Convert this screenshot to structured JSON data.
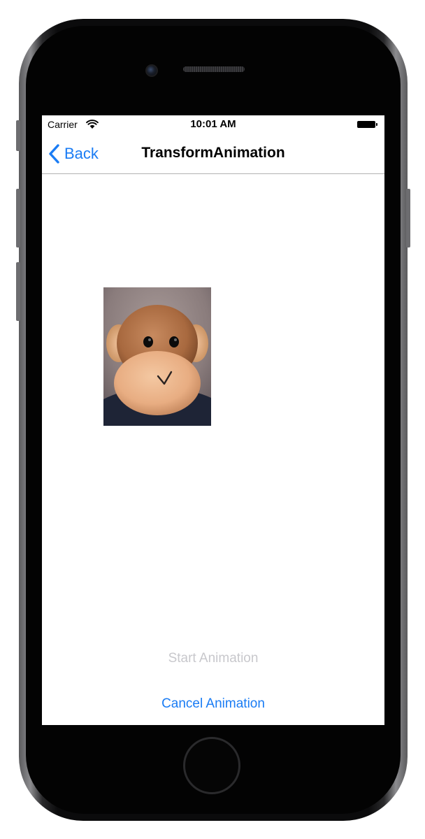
{
  "status_bar": {
    "carrier": "Carrier",
    "time": "10:01 AM",
    "wifi_icon": "wifi-icon",
    "battery_icon": "battery-icon",
    "battery_level": 1.0
  },
  "nav_bar": {
    "back_label": "Back",
    "back_icon": "chevron-left-icon",
    "title": "TransformAnimation"
  },
  "content": {
    "image_subject": "monkey plush toy photo"
  },
  "buttons": {
    "start_label": "Start Animation",
    "start_enabled": false,
    "cancel_label": "Cancel Animation",
    "cancel_enabled": true
  },
  "colors": {
    "tint": "#1a7cf4",
    "disabled": "#c8c8cc"
  }
}
